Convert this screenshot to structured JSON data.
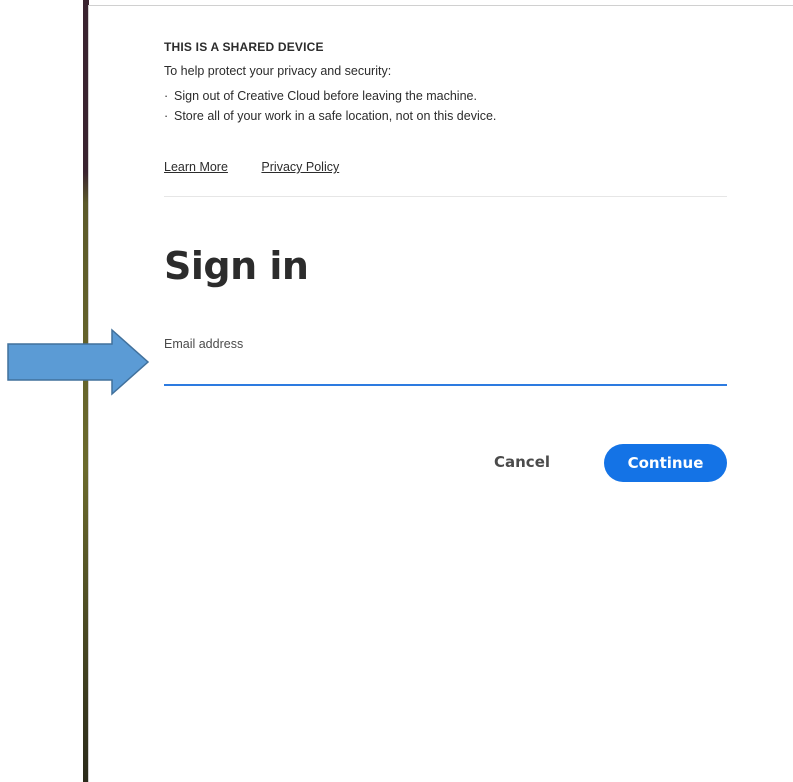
{
  "notice": {
    "title": "THIS IS A SHARED DEVICE",
    "intro": "To help protect your privacy and security:",
    "items": [
      "Sign out of Creative Cloud before leaving the machine.",
      "Store all of your work in a safe location, not on this device."
    ]
  },
  "links": {
    "learn_more": "Learn More",
    "privacy_policy": "Privacy Policy"
  },
  "signin": {
    "title": "Sign in",
    "email_label": "Email address",
    "email_value": ""
  },
  "buttons": {
    "cancel": "Cancel",
    "continue": "Continue"
  },
  "colors": {
    "accent": "#1473e6",
    "input_underline": "#2d7be0",
    "annotation_arrow": "#5b9bd5"
  },
  "annotation": {
    "icon": "right-arrow-icon"
  }
}
